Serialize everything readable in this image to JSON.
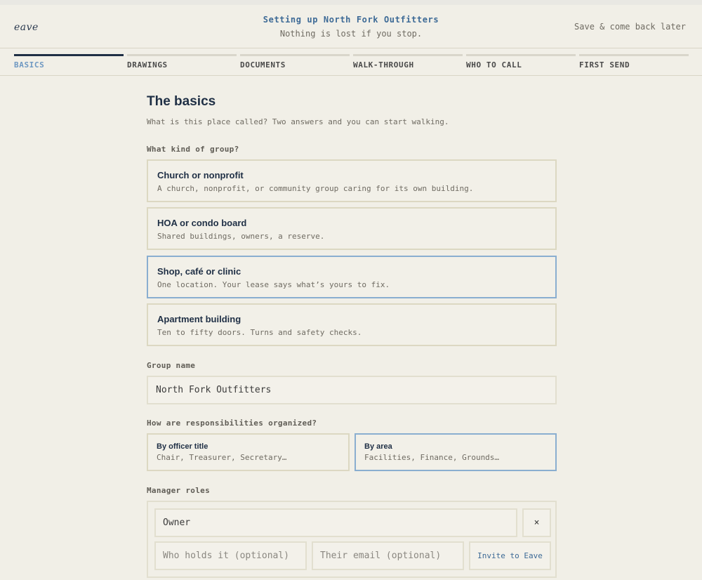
{
  "header": {
    "logo": "eave",
    "title": "Setting up North Fork Outfitters",
    "subtitle": "Nothing is lost if you stop.",
    "save_link": "Save & come back later"
  },
  "tabs": [
    {
      "label": "BASICS",
      "active": true
    },
    {
      "label": "DRAWINGS",
      "active": false
    },
    {
      "label": "DOCUMENTS",
      "active": false
    },
    {
      "label": "WALK-THROUGH",
      "active": false
    },
    {
      "label": "WHO TO CALL",
      "active": false
    },
    {
      "label": "FIRST SEND",
      "active": false
    }
  ],
  "main": {
    "title": "The basics",
    "intro": "What is this place called? Two answers and you can start walking.",
    "group_kind": {
      "label": "What kind of group?",
      "options": [
        {
          "title": "Church or nonprofit",
          "desc": "A church, nonprofit, or community group caring for its own building.",
          "selected": false
        },
        {
          "title": "HOA or condo board",
          "desc": "Shared buildings, owners, a reserve.",
          "selected": false
        },
        {
          "title": "Shop, café or clinic",
          "desc": "One location. Your lease says what’s yours to fix.",
          "selected": true
        },
        {
          "title": "Apartment building",
          "desc": "Ten to fifty doors. Turns and safety checks.",
          "selected": false
        }
      ]
    },
    "group_name": {
      "label": "Group name",
      "value": "North Fork Outfitters"
    },
    "responsibilities": {
      "label": "How are responsibilities organized?",
      "options": [
        {
          "title": "By officer title",
          "desc": "Chair, Treasurer, Secretary…",
          "selected": false
        },
        {
          "title": "By area",
          "desc": "Facilities, Finance, Grounds…",
          "selected": true
        }
      ]
    },
    "manager_roles": {
      "label": "Manager roles",
      "role_value": "Owner",
      "remove_symbol": "×",
      "holder_placeholder": "Who holds it (optional)",
      "email_placeholder": "Their email (optional)",
      "invite_label": "Invite to Eave"
    }
  },
  "colors": {
    "background": "#f1efe7",
    "accent_blue": "#6e98c2",
    "selected_border": "#8aaed0",
    "ink": "#1f2f45"
  }
}
